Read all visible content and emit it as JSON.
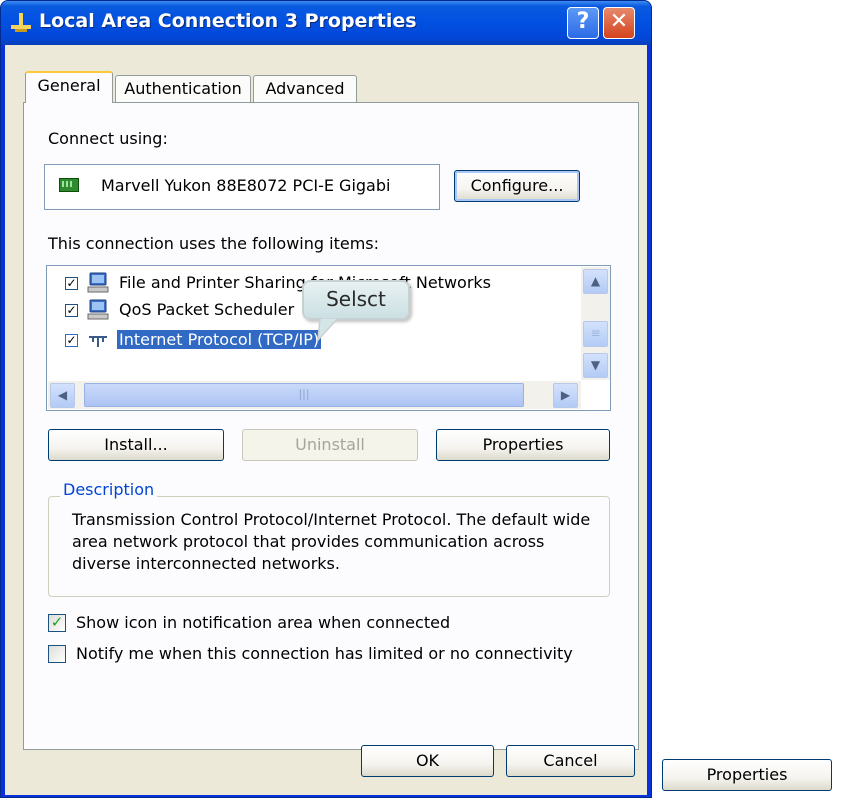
{
  "window": {
    "title": "Local Area Connection 3 Properties",
    "help_glyph": "?",
    "close_glyph": "✕"
  },
  "tabs": [
    {
      "label": "General",
      "active": true
    },
    {
      "label": "Authentication",
      "active": false
    },
    {
      "label": "Advanced",
      "active": false
    }
  ],
  "general": {
    "connect_using_label": "Connect using:",
    "adapter_name": "Marvell Yukon 88E8072 PCI-E Gigabi",
    "configure_label": "Configure...",
    "items_label": "This connection uses the following items:",
    "items": [
      {
        "label": "File and Printer Sharing for Microsoft Networks",
        "checked": true,
        "icon": "network-service-icon"
      },
      {
        "label": "QoS Packet Scheduler",
        "checked": true,
        "icon": "network-service-icon"
      },
      {
        "label": "Internet Protocol (TCP/IP)",
        "checked": true,
        "selected": true,
        "icon": "protocol-icon"
      }
    ],
    "install_label": "Install...",
    "uninstall_label": "Uninstall",
    "properties_label": "Properties",
    "description_title": "Description",
    "description_text": "Transmission Control Protocol/Internet Protocol. The default wide area network protocol that provides communication across diverse interconnected networks.",
    "show_icon_label": "Show icon in notification area when connected",
    "show_icon_checked": true,
    "notify_label": "Notify me when this connection has limited or no connectivity",
    "notify_checked": false
  },
  "footer": {
    "ok_label": "OK",
    "cancel_label": "Cancel"
  },
  "callout": {
    "text": "Selsct"
  },
  "extra_button": {
    "label": "Properties"
  },
  "colors": {
    "titlebar": "#0150e2",
    "selection": "#316ac5",
    "dialog_bg": "#ece9d8",
    "tab_highlight": "#ffc83c"
  }
}
